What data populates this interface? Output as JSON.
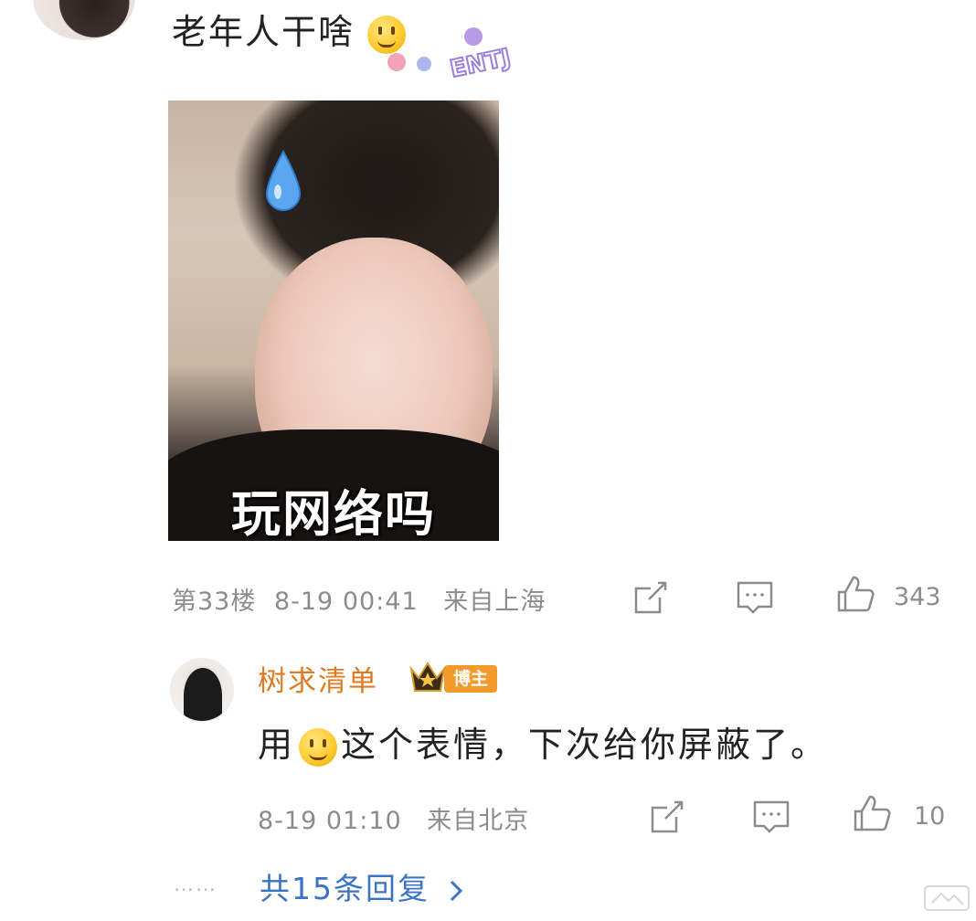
{
  "comment": {
    "text": "老年人干啥",
    "badge_text": "ENTJ",
    "meme_caption": "玩网络吗",
    "floor": "第33楼",
    "datetime": "8-19 00:41",
    "location": "来自上海",
    "likes": "343"
  },
  "reply": {
    "author": "树求清单",
    "author_tag": "博主",
    "text_before": "用",
    "text_after": "这个表情，下次给你屏蔽了。",
    "datetime": "8-19 01:10",
    "location": "来自北京",
    "likes": "10"
  },
  "more": {
    "dots": "……",
    "label": "共15条回复"
  },
  "icons": [
    "share-icon",
    "comment-icon",
    "like-icon",
    "smiley-icon",
    "crown-icon",
    "chevron-right-icon"
  ],
  "colors": {
    "author_name": "#e07a1f",
    "blogger_badge": "#f29a2b",
    "link": "#3b74c4",
    "meta": "#8c8c8c"
  }
}
